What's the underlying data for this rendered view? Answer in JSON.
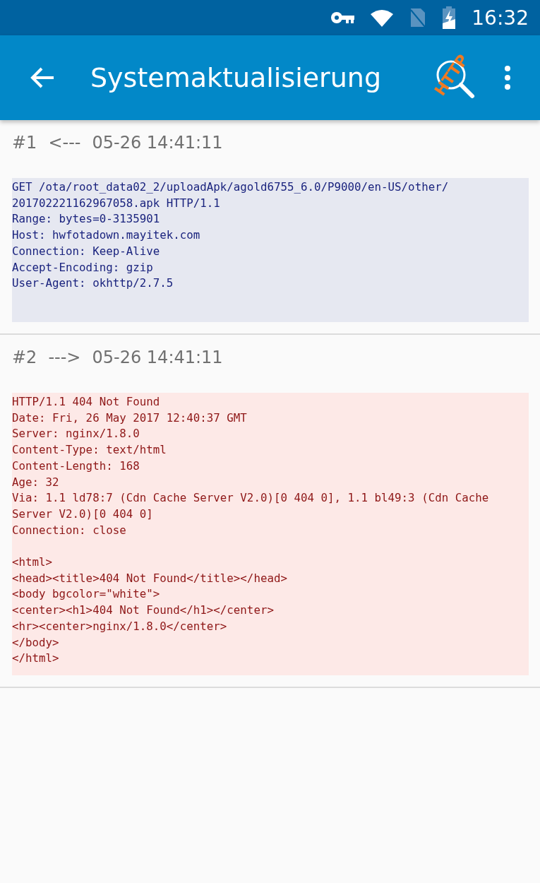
{
  "status_bar": {
    "time": "16:32"
  },
  "app_bar": {
    "title": "Systemaktualisierung",
    "logo_text": "HTTP"
  },
  "entries": [
    {
      "kind": "request",
      "number": "#1",
      "direction": "<---",
      "timestamp": "05-26 14:41:11",
      "paragraphs": [
        [
          "GET /ota/root_data02_2/uploadApk/agold6755_6.0/P9000/en-US/other/",
          "201702221162967058.apk HTTP/1.1",
          "Range: bytes=0-3135901",
          "Host: hwfotadown.mayitek.com",
          "Connection: Keep-Alive",
          "Accept-Encoding: gzip",
          "User-Agent: okhttp/2.7.5"
        ]
      ]
    },
    {
      "kind": "response",
      "number": "#2",
      "direction": "--->",
      "timestamp": "05-26 14:41:11",
      "paragraphs": [
        [
          "HTTP/1.1 404 Not Found",
          "Date: Fri, 26 May 2017 12:40:37 GMT",
          "Server: nginx/1.8.0",
          "Content-Type: text/html",
          "Content-Length: 168",
          "Age: 32",
          "Via: 1.1 ld78:7 (Cdn Cache Server V2.0)[0 404 0], 1.1 bl49:3 (Cdn Cache",
          "Server V2.0)[0 404 0]",
          "Connection: close"
        ],
        [
          "<html>",
          "<head><title>404 Not Found</title></head>",
          "<body bgcolor=\"white\">",
          "<center><h1>404 Not Found</h1></center>",
          "<hr><center>nginx/1.8.0</center>",
          "</body>",
          "</html>"
        ]
      ]
    }
  ]
}
